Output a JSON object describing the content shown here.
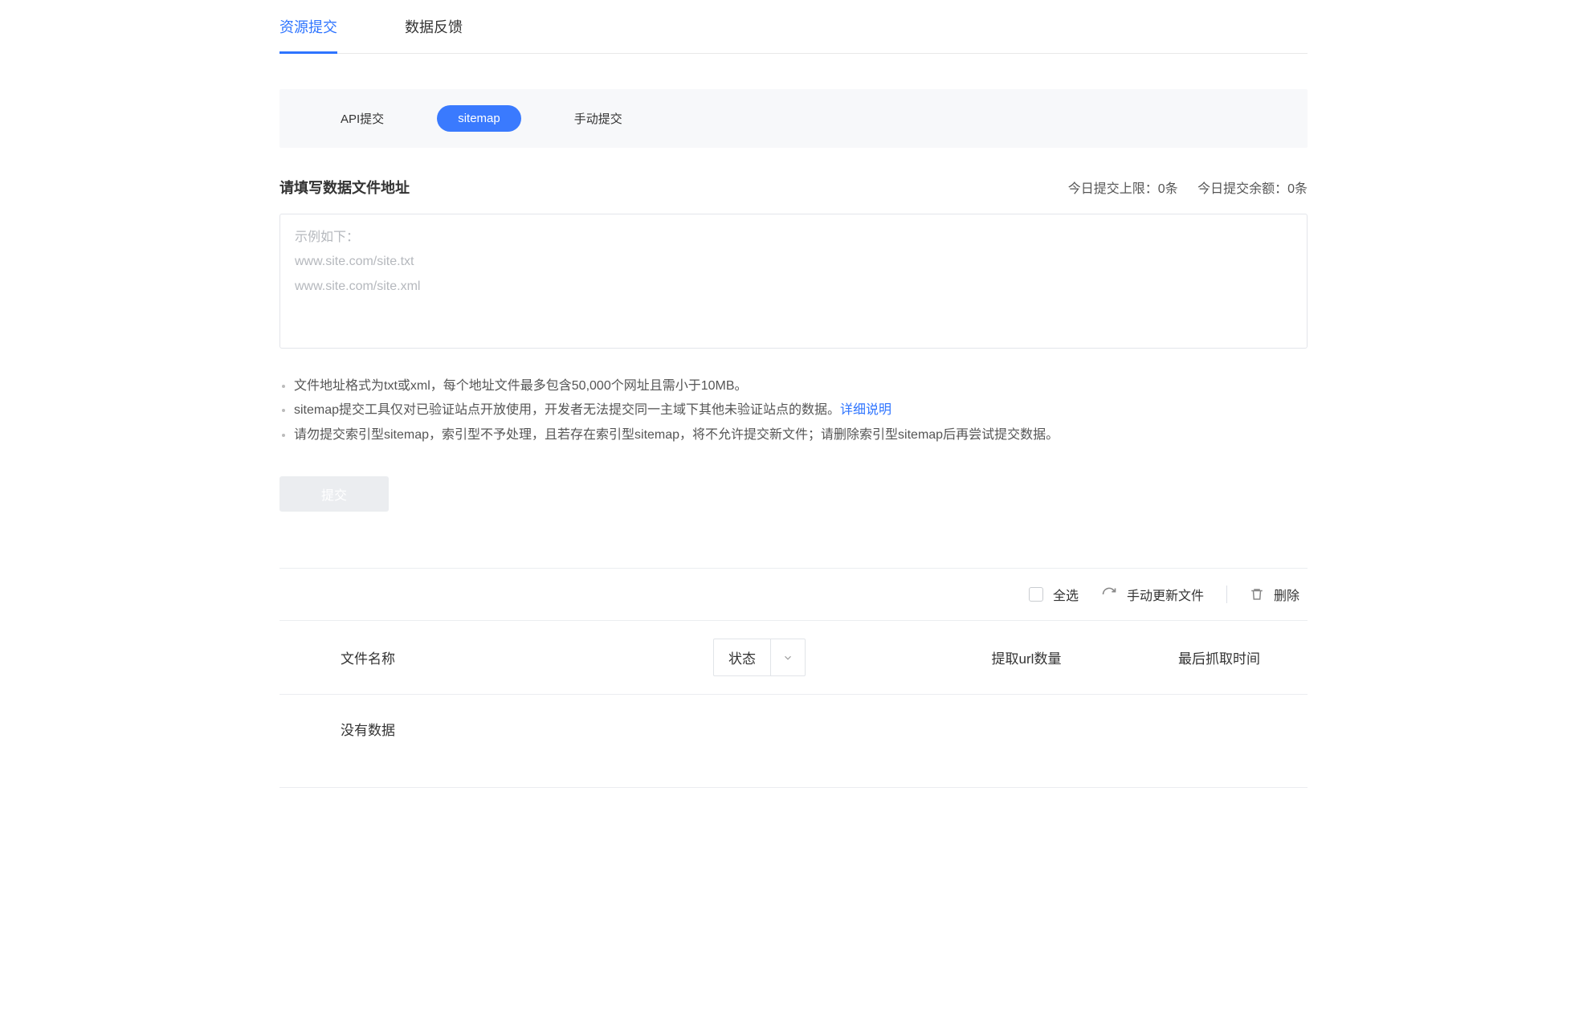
{
  "top_tabs": [
    {
      "label": "资源提交",
      "active": true
    },
    {
      "label": "数据反馈",
      "active": false
    }
  ],
  "sub_tabs": [
    {
      "label": "API提交",
      "active": false
    },
    {
      "label": "sitemap",
      "active": true
    },
    {
      "label": "手动提交",
      "active": false
    }
  ],
  "section": {
    "title": "请填写数据文件地址",
    "quota_limit": "今日提交上限：0条",
    "quota_remaining": "今日提交余额：0条"
  },
  "textarea_placeholder": "示例如下：\nwww.site.com/site.txt\nwww.site.com/site.xml",
  "hints": [
    "文件地址格式为txt或xml，每个地址文件最多包含50,000个网址且需小于10MB。",
    "sitemap提交工具仅对已验证站点开放使用，开发者无法提交同一主域下其他未验证站点的数据。",
    "请勿提交索引型sitemap，索引型不予处理，且若存在索引型sitemap，将不允许提交新文件；请删除索引型sitemap后再尝试提交数据。"
  ],
  "hint_link": {
    "label": "详细说明"
  },
  "submit_label": "提交",
  "table": {
    "actions": {
      "select_all": "全选",
      "refresh": "手动更新文件",
      "delete": "删除"
    },
    "headers": {
      "name": "文件名称",
      "status": "状态",
      "count": "提取url数量",
      "time": "最后抓取时间"
    },
    "empty": "没有数据"
  }
}
